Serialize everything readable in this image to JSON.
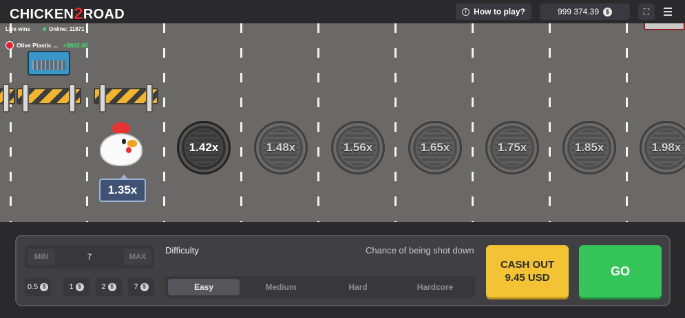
{
  "header": {
    "logo_part1": "CHICKEN",
    "logo_two": "2",
    "logo_part2": "ROAD",
    "how_to_play": "How to play?",
    "balance": "999 374.39",
    "currency_symbol": "$"
  },
  "feed": {
    "live_wins": "Live wins",
    "online": "Online: 11871",
    "winner_name": "Olive Plastic ...",
    "winner_amount": "+$822.00"
  },
  "road": {
    "current_multiplier": "1.35x",
    "multipliers": [
      "1.42x",
      "1.48x",
      "1.56x",
      "1.65x",
      "1.75x",
      "1.85x",
      "1.98x"
    ]
  },
  "bet": {
    "min_label": "MIN",
    "max_label": "MAX",
    "amount": "7",
    "quick_bets": [
      "0.5",
      "1",
      "2",
      "7"
    ]
  },
  "difficulty": {
    "label": "Difficulty",
    "chance_label": "Chance of being shot down",
    "options": [
      "Easy",
      "Medium",
      "Hard",
      "Hardcore"
    ],
    "selected": "Easy"
  },
  "actions": {
    "cashout_line1": "CASH OUT",
    "cashout_line2": "9.45 USD",
    "go": "GO"
  },
  "colors": {
    "road": "#6b6968",
    "cashout": "#f3c235",
    "go": "#35c55a",
    "win_green": "#47e36a",
    "logo_red": "#e32b2b"
  }
}
